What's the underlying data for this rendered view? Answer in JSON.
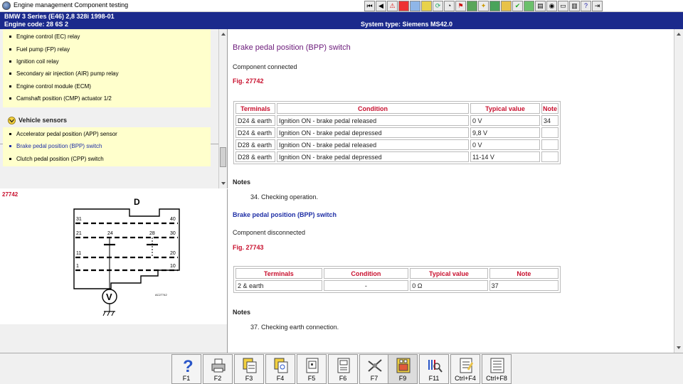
{
  "window": {
    "title": "Engine management Component testing"
  },
  "header": {
    "vehicle": "BMW   3 Series (E46) 2,8 328i 1998-01",
    "engine_code": "Engine code: 28 6S 2",
    "system_type": "System type: Siemens MS42.0"
  },
  "toolbar": {
    "icons": [
      "first-icon",
      "back-icon",
      "warning-icon",
      "stop-icon",
      "image-icon",
      "tools-icon",
      "refresh-icon",
      "gauge-icon",
      "flag-icon",
      "spanner-icon",
      "bulb-icon",
      "wrench-icon",
      "folder-icon",
      "check-icon",
      "chart-icon",
      "page-icon",
      "camera-icon",
      "display-icon",
      "print-icon",
      "help-icon",
      "exit-icon"
    ]
  },
  "sidebar": {
    "list1": [
      "Engine control (EC) relay",
      "Fuel pump (FP) relay",
      "Ignition coil relay",
      "Secondary air injection (AIR) pump relay",
      "Engine control module (ECM)",
      "Camshaft position (CMP) actuator 1/2"
    ],
    "section_label": "Vehicle sensors",
    "list2": [
      "Accelerator pedal position (APP) sensor",
      "Brake pedal position (BPP) switch",
      "Clutch pedal position (CPP) switch"
    ],
    "selected_index": 1
  },
  "figure": {
    "label": "27742",
    "connector_letter": "D",
    "pins": [
      "31",
      "40",
      "21",
      "24",
      "28",
      "30",
      "11",
      "20",
      "1",
      "10"
    ],
    "meter": "V",
    "code": "AC27742"
  },
  "content": {
    "title1": "Brake pedal position (BPP) switch",
    "status1": "Component connected",
    "fig1": "Fig. 27742",
    "table1": {
      "headers": [
        "Terminals",
        "Condition",
        "Typical value",
        "Note"
      ],
      "rows": [
        [
          "D24 & earth",
          "Ignition ON - brake pedal released",
          "0 V",
          "34"
        ],
        [
          "D24 & earth",
          "Ignition ON - brake pedal depressed",
          "9,8 V",
          ""
        ],
        [
          "D28 & earth",
          "Ignition ON - brake pedal released",
          "0 V",
          ""
        ],
        [
          "D28 & earth",
          "Ignition ON - brake pedal depressed",
          "11-14 V",
          ""
        ]
      ]
    },
    "notes1_heading": "Notes",
    "note1": "34. Checking operation.",
    "title2": "Brake pedal position (BPP) switch",
    "status2": "Component disconnected",
    "fig2": "Fig. 27743",
    "table2": {
      "headers": [
        "Terminals",
        "Condition",
        "Typical value",
        "Note"
      ],
      "rows": [
        [
          "2 & earth",
          "-",
          "0 Ω",
          "37"
        ]
      ]
    },
    "notes2_heading": "Notes",
    "note2": "37. Checking earth connection."
  },
  "fkeys": [
    {
      "label": "F1",
      "icon": "help-icon"
    },
    {
      "label": "F2",
      "icon": "print-icon"
    },
    {
      "label": "F3",
      "icon": "copy-pages-icon"
    },
    {
      "label": "F4",
      "icon": "search-pages-icon"
    },
    {
      "label": "F5",
      "icon": "connector-icon"
    },
    {
      "label": "F6",
      "icon": "module-icon"
    },
    {
      "label": "F7",
      "icon": "probe-icon"
    },
    {
      "label": "F9",
      "icon": "diagram-icon"
    },
    {
      "label": "F11",
      "icon": "zoom-icon"
    },
    {
      "label": "Ctrl+F4",
      "icon": "notes-icon"
    },
    {
      "label": "Ctrl+F8",
      "icon": "list-icon"
    }
  ],
  "colors": {
    "header_bg": "#1b2a8c",
    "list_bg": "#ffffcc",
    "accent_red": "#c8102e",
    "title_purple": "#6b1a7a",
    "link_blue": "#1f2fa6"
  }
}
